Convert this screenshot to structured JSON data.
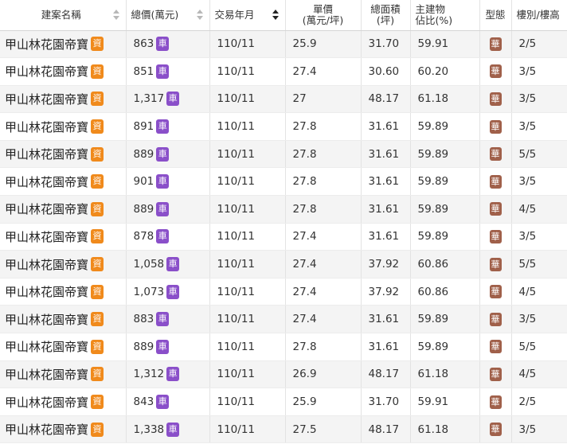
{
  "columns": [
    "建案名稱",
    "總價(萬元)",
    "交易年月",
    "單價\n(萬元/坪)",
    "總面積\n(坪)",
    "主建物\n佔比(%)",
    "型態",
    "樓別/樓高"
  ],
  "badges": {
    "detail": "資",
    "parking": "車",
    "type": "華"
  },
  "colors": {
    "detail_badge": "#f08a1c",
    "parking_badge": "#8a4fc9",
    "type_badge": "#a0604a"
  },
  "sorted_column": "交易年月",
  "rows": [
    {
      "name": "甲山林花園帝寶",
      "price": "863",
      "date": "110/11",
      "unit": "25.9",
      "area": "31.70",
      "ratio": "59.91",
      "floor": "2/5"
    },
    {
      "name": "甲山林花園帝寶",
      "price": "851",
      "date": "110/11",
      "unit": "27.4",
      "area": "30.60",
      "ratio": "60.20",
      "floor": "3/5"
    },
    {
      "name": "甲山林花園帝寶",
      "price": "1,317",
      "date": "110/11",
      "unit": "27",
      "area": "48.17",
      "ratio": "61.18",
      "floor": "3/5"
    },
    {
      "name": "甲山林花園帝寶",
      "price": "891",
      "date": "110/11",
      "unit": "27.8",
      "area": "31.61",
      "ratio": "59.89",
      "floor": "3/5"
    },
    {
      "name": "甲山林花園帝寶",
      "price": "889",
      "date": "110/11",
      "unit": "27.8",
      "area": "31.61",
      "ratio": "59.89",
      "floor": "5/5"
    },
    {
      "name": "甲山林花園帝寶",
      "price": "901",
      "date": "110/11",
      "unit": "27.8",
      "area": "31.61",
      "ratio": "59.89",
      "floor": "3/5"
    },
    {
      "name": "甲山林花園帝寶",
      "price": "889",
      "date": "110/11",
      "unit": "27.8",
      "area": "31.61",
      "ratio": "59.89",
      "floor": "4/5"
    },
    {
      "name": "甲山林花園帝寶",
      "price": "878",
      "date": "110/11",
      "unit": "27.4",
      "area": "31.61",
      "ratio": "59.89",
      "floor": "3/5"
    },
    {
      "name": "甲山林花園帝寶",
      "price": "1,058",
      "date": "110/11",
      "unit": "27.4",
      "area": "37.92",
      "ratio": "60.86",
      "floor": "5/5"
    },
    {
      "name": "甲山林花園帝寶",
      "price": "1,073",
      "date": "110/11",
      "unit": "27.4",
      "area": "37.92",
      "ratio": "60.86",
      "floor": "4/5"
    },
    {
      "name": "甲山林花園帝寶",
      "price": "883",
      "date": "110/11",
      "unit": "27.4",
      "area": "31.61",
      "ratio": "59.89",
      "floor": "3/5"
    },
    {
      "name": "甲山林花園帝寶",
      "price": "889",
      "date": "110/11",
      "unit": "27.8",
      "area": "31.61",
      "ratio": "59.89",
      "floor": "5/5"
    },
    {
      "name": "甲山林花園帝寶",
      "price": "1,312",
      "date": "110/11",
      "unit": "26.9",
      "area": "48.17",
      "ratio": "61.18",
      "floor": "4/5"
    },
    {
      "name": "甲山林花園帝寶",
      "price": "843",
      "date": "110/11",
      "unit": "25.9",
      "area": "31.70",
      "ratio": "59.91",
      "floor": "2/5"
    },
    {
      "name": "甲山林花園帝寶",
      "price": "1,338",
      "date": "110/11",
      "unit": "27.5",
      "area": "48.17",
      "ratio": "61.18",
      "floor": "3/5"
    }
  ]
}
